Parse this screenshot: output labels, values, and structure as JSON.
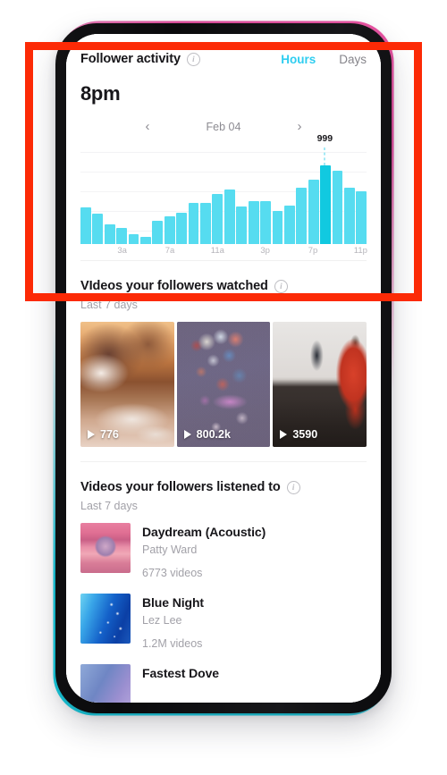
{
  "annotation": {
    "color": "#fc2a06"
  },
  "follower_activity": {
    "title": "Follower activity",
    "info_glyph": "i",
    "tabs": [
      {
        "label": "Hours",
        "active": true
      },
      {
        "label": "Days",
        "active": false
      }
    ],
    "peak_hour": "8pm",
    "date": {
      "prev_glyph": "‹",
      "label": "Feb 04",
      "next_glyph": "›"
    },
    "chart_data": {
      "type": "bar",
      "title": "Follower activity",
      "xlabel": "",
      "ylabel": "",
      "grid": true,
      "gridlines": 5,
      "legend": "none",
      "bar_color": "#56dcf0",
      "highlight_color": "#11c9e0",
      "ylim": [
        0,
        1250
      ],
      "highlight_index": 20,
      "highlight_value": 999,
      "highlight_label": "999",
      "categories": [
        "12a",
        "1a",
        "2a",
        "3a",
        "4a",
        "5a",
        "6a",
        "7a",
        "8a",
        "9a",
        "10a",
        "11a",
        "12p",
        "1p",
        "2p",
        "3p",
        "4p",
        "5p",
        "6p",
        "7p",
        "8p",
        "9p",
        "10p",
        "11p"
      ],
      "tick_labels": [
        {
          "label": "3a",
          "index": 3
        },
        {
          "label": "7a",
          "index": 7
        },
        {
          "label": "11a",
          "index": 11
        },
        {
          "label": "3p",
          "index": 15
        },
        {
          "label": "7p",
          "index": 19
        },
        {
          "label": "11p",
          "index": 23
        }
      ],
      "values": [
        470,
        390,
        250,
        205,
        130,
        95,
        300,
        355,
        400,
        520,
        520,
        635,
        690,
        480,
        545,
        545,
        415,
        490,
        720,
        820,
        999,
        930,
        715,
        670
      ]
    }
  },
  "videos_watched": {
    "title": "VIdeos your followers watched",
    "info_glyph": "i",
    "subtitle": "Last 7 days",
    "items": [
      {
        "views": "776",
        "art": "art1",
        "alt": "motorbike-in-snow-at-sunset"
      },
      {
        "views": "800.2k",
        "art": "art2",
        "alt": "blue-bokeh-lights"
      },
      {
        "views": "3590",
        "art": "art3",
        "alt": "woman-in-red-at-desk"
      }
    ]
  },
  "sounds_listened": {
    "title": "Videos your followers listened to",
    "info_glyph": "i",
    "subtitle": "Last 7 days",
    "tracks": [
      {
        "title": "Daydream (Acoustic)",
        "artist": "Patty Ward",
        "count": "6773 videos",
        "art": "art-daydream"
      },
      {
        "title": "Blue Night",
        "artist": "Lez Lee",
        "count": "1.2M videos",
        "art": "art-bluenight"
      },
      {
        "title": "Fastest Dove",
        "artist": "",
        "count": "",
        "art": "art-fastest"
      }
    ]
  }
}
